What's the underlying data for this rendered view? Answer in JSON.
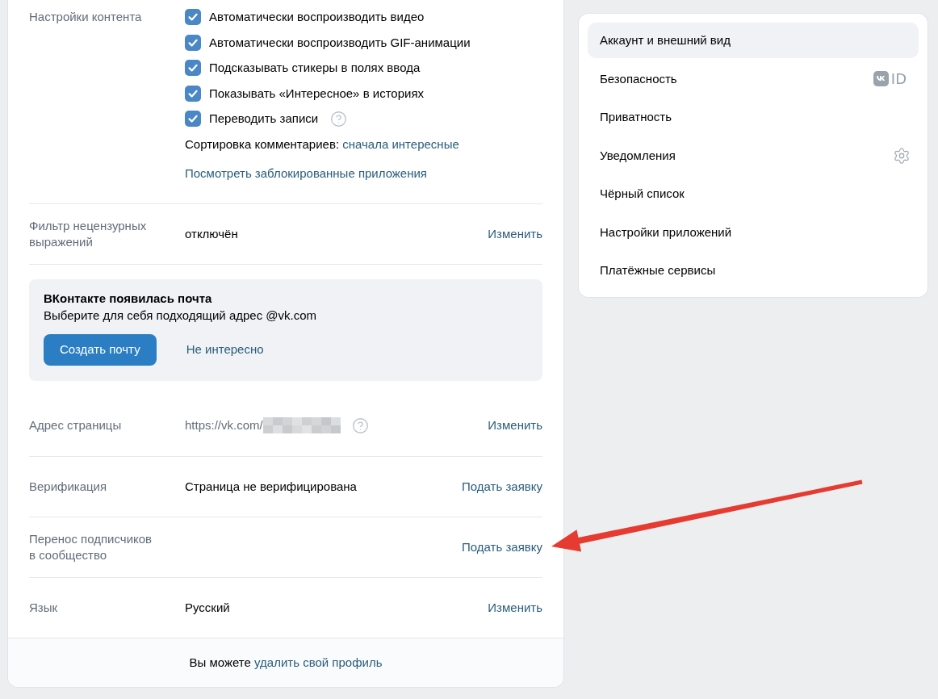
{
  "sections": [
    {
      "kind": "content",
      "label": "Настройки контента",
      "options": [
        {
          "label": "Автоматически воспроизводить видео",
          "checked": true,
          "help": false
        },
        {
          "label": "Автоматически воспроизводить GIF-анимации",
          "checked": true,
          "help": false
        },
        {
          "label": "Подсказывать стикеры в полях ввода",
          "checked": true,
          "help": false
        },
        {
          "label": "Показывать «Интересное» в историях",
          "checked": true,
          "help": false
        },
        {
          "label": "Переводить записи",
          "checked": true,
          "help": true
        }
      ],
      "sort_label": "Сортировка комментариев:",
      "sort_value": "сначала интересные",
      "link": "Посмотреть заблокированные приложения"
    },
    {
      "kind": "row",
      "label": "Фильтр нецензурных выражений",
      "value": "отключён",
      "blurred": false,
      "help": false,
      "action": "Изменить"
    },
    {
      "kind": "promo",
      "title": "ВКонтакте появилась почта",
      "text": "Выберите для себя подходящий адрес @vk.com",
      "button": "Создать почту",
      "dismiss": "Не интересно"
    },
    {
      "kind": "row",
      "label": "Адрес страницы",
      "value": "https://vk.com/",
      "blurred": true,
      "help": true,
      "action": "Изменить"
    },
    {
      "kind": "row",
      "label": "Верификация",
      "value": "Страница не верифицирована",
      "blurred": false,
      "help": false,
      "action": "Подать заявку"
    },
    {
      "kind": "row",
      "label": "Перенос подписчиков в сообщество",
      "blurred": false,
      "help": false,
      "action": "Подать заявку"
    },
    {
      "kind": "row",
      "label": "Язык",
      "value": "Русский",
      "blurred": false,
      "help": false,
      "action": "Изменить"
    }
  ],
  "footer": {
    "text": "Вы можете",
    "link": "удалить свой профиль"
  },
  "menu": {
    "items": [
      {
        "label": "Аккаунт и внешний вид",
        "selected": true,
        "kind": "plain"
      },
      {
        "label": "Безопасность",
        "selected": false,
        "kind": "vk-id",
        "badge": "ID"
      },
      {
        "label": "Приватность",
        "selected": false,
        "kind": "plain"
      },
      {
        "label": "Уведомления",
        "selected": false,
        "kind": "settings"
      },
      {
        "label": "Чёрный список",
        "selected": false,
        "kind": "plain"
      },
      {
        "label": "Настройки приложений",
        "selected": false,
        "kind": "plain"
      },
      {
        "label": "Платёжные сервисы",
        "selected": false,
        "kind": "plain"
      }
    ]
  }
}
